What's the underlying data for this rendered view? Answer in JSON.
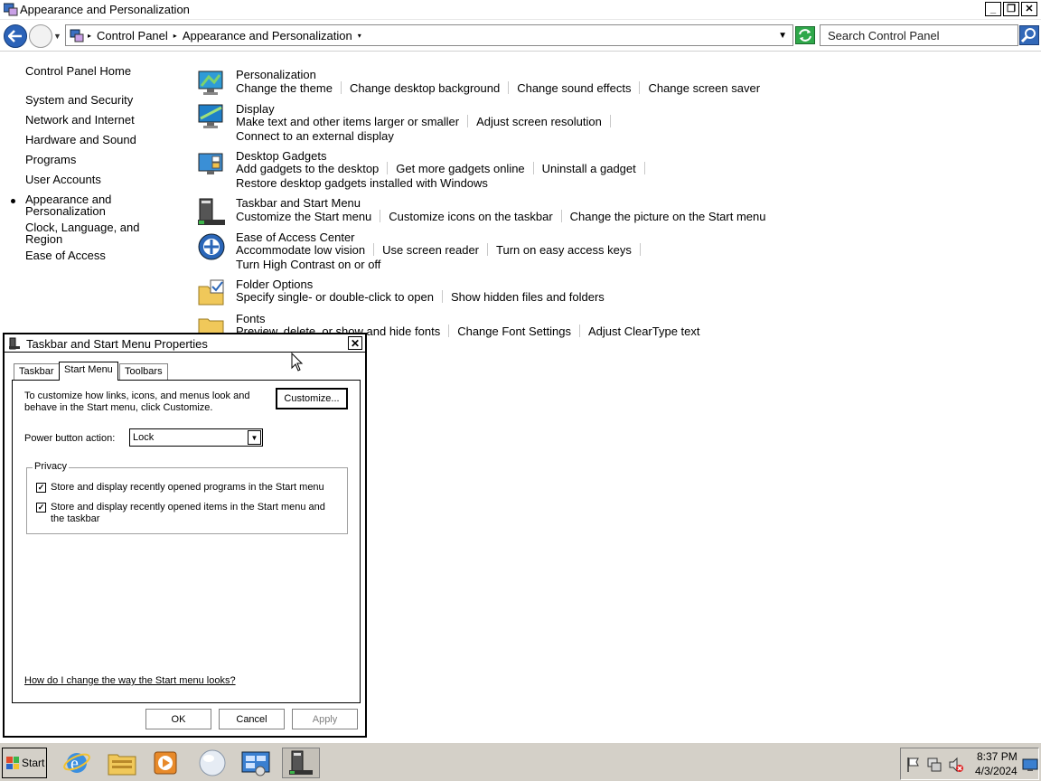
{
  "window": {
    "title": "Appearance and Personalization",
    "minimize": "_",
    "restore": "❐",
    "close": "✕"
  },
  "address": {
    "crumbs": [
      "Control Panel",
      "Appearance and Personalization"
    ],
    "search_placeholder": "Search Control Panel"
  },
  "sidebar": {
    "home": "Control Panel Home",
    "items": [
      "System and Security",
      "Network and Internet",
      "Hardware and Sound",
      "Programs",
      "User Accounts",
      "Appearance and",
      "Personalization",
      "Clock, Language, and",
      "Region",
      "Ease of Access"
    ]
  },
  "categories": [
    {
      "title": "Personalization",
      "lines": [
        [
          "Change the theme",
          "Change desktop background",
          "Change sound effects",
          "Change screen saver"
        ]
      ]
    },
    {
      "title": "Display",
      "lines": [
        [
          "Make text and other items larger or smaller",
          "Adjust screen resolution"
        ],
        [
          "Connect to an external display"
        ]
      ]
    },
    {
      "title": "Desktop Gadgets",
      "lines": [
        [
          "Add gadgets to the desktop",
          "Get more gadgets online",
          "Uninstall a gadget"
        ],
        [
          "Restore desktop gadgets installed with Windows"
        ]
      ]
    },
    {
      "title": "Taskbar and Start Menu",
      "lines": [
        [
          "Customize the Start menu",
          "Customize icons on the taskbar",
          "Change the picture on the Start menu"
        ]
      ]
    },
    {
      "title": "Ease of Access Center",
      "lines": [
        [
          "Accommodate low vision",
          "Use screen reader",
          "Turn on easy access keys"
        ],
        [
          "Turn High Contrast on or off"
        ]
      ]
    },
    {
      "title": "Folder Options",
      "lines": [
        [
          "Specify single- or double-click to open",
          "Show hidden files and folders"
        ]
      ]
    },
    {
      "title": "Fonts",
      "lines": [
        [
          "Preview, delete, or show and hide fonts",
          "Change Font Settings",
          "Adjust ClearType text"
        ]
      ]
    }
  ],
  "dialog": {
    "title": "Taskbar and Start Menu Properties",
    "close": "✕",
    "tabs": [
      "Taskbar",
      "Start Menu",
      "Toolbars"
    ],
    "description": "To customize how links, icons, and menus look and behave in the Start menu, click Customize.",
    "customize": "Customize...",
    "power_label": "Power button action:",
    "power_value": "Lock",
    "privacy_legend": "Privacy",
    "check1": "Store and display recently opened programs in the Start menu",
    "check2": "Store and display recently opened items in the Start menu and the taskbar",
    "check_mark": "✓",
    "help_link": "How do I change the way the Start menu looks?",
    "ok": "OK",
    "cancel": "Cancel",
    "apply": "Apply"
  },
  "taskbar": {
    "start": "Start",
    "time": "8:37 PM",
    "date": "4/3/2024"
  },
  "colors": {
    "accent_blue": "#2c63b8",
    "refresh_green": "#2fa84a",
    "taskbar_gray": "#d4d0c8"
  }
}
